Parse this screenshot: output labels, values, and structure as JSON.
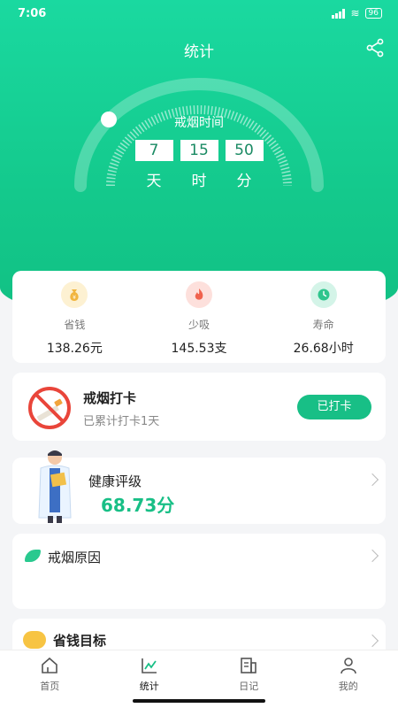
{
  "status": {
    "time": "7:06",
    "battery": "96"
  },
  "header": {
    "title": "统计"
  },
  "gauge": {
    "label": "戒烟时间",
    "days": "7",
    "hours": "15",
    "minutes": "50",
    "day_unit": "天",
    "hour_unit": "时",
    "minute_unit": "分"
  },
  "stats": [
    {
      "label": "省钱",
      "value": "138.26元",
      "icon": "money-bag-icon"
    },
    {
      "label": "少吸",
      "value": "145.53支",
      "icon": "flame-icon"
    },
    {
      "label": "寿命",
      "value": "26.68小时",
      "icon": "clock-icon"
    }
  ],
  "checkin": {
    "title": "戒烟打卡",
    "subtitle": "已累计打卡1天",
    "button": "已打卡"
  },
  "health": {
    "title": "健康评级",
    "score": "68.73分"
  },
  "reason": {
    "title": "戒烟原因"
  },
  "saving": {
    "title": "省钱目标"
  },
  "tabs": [
    {
      "label": "首页",
      "icon": "home-icon"
    },
    {
      "label": "统计",
      "icon": "chart-icon"
    },
    {
      "label": "日记",
      "icon": "diary-icon"
    },
    {
      "label": "我的",
      "icon": "profile-icon"
    }
  ],
  "colors": {
    "primary": "#18bf86",
    "hero_top": "#1ad9a0"
  }
}
